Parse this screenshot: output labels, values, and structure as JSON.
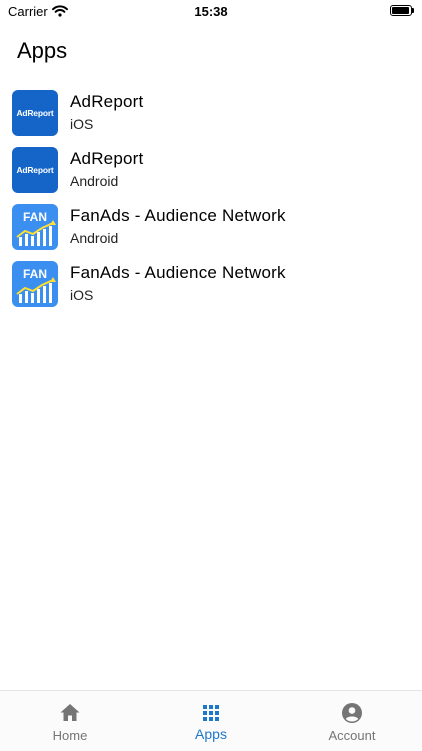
{
  "status_bar": {
    "carrier": "Carrier",
    "time": "15:38"
  },
  "page_title": "Apps",
  "apps": [
    {
      "name": "AdReport",
      "platform": "iOS",
      "icon_text": "AdReport",
      "icon": "adreport-icon"
    },
    {
      "name": "AdReport",
      "platform": "Android",
      "icon_text": "AdReport",
      "icon": "adreport-icon"
    },
    {
      "name": "FanAds - Audience Network",
      "platform": "Android",
      "icon_text": "FAN",
      "icon": "fan-chart-icon"
    },
    {
      "name": "FanAds - Audience Network",
      "platform": "iOS",
      "icon_text": "FAN",
      "icon": "fan-chart-icon"
    }
  ],
  "tabs": [
    {
      "label": "Home",
      "icon": "home-icon",
      "active": false
    },
    {
      "label": "Apps",
      "icon": "grid-icon",
      "active": true
    },
    {
      "label": "Account",
      "icon": "account-icon",
      "active": false
    }
  ],
  "colors": {
    "accent": "#1e78c8",
    "adreport_icon_bg": "#1565c8",
    "fan_icon_bg": "#3b8ff0",
    "inactive_tab": "#757575"
  }
}
